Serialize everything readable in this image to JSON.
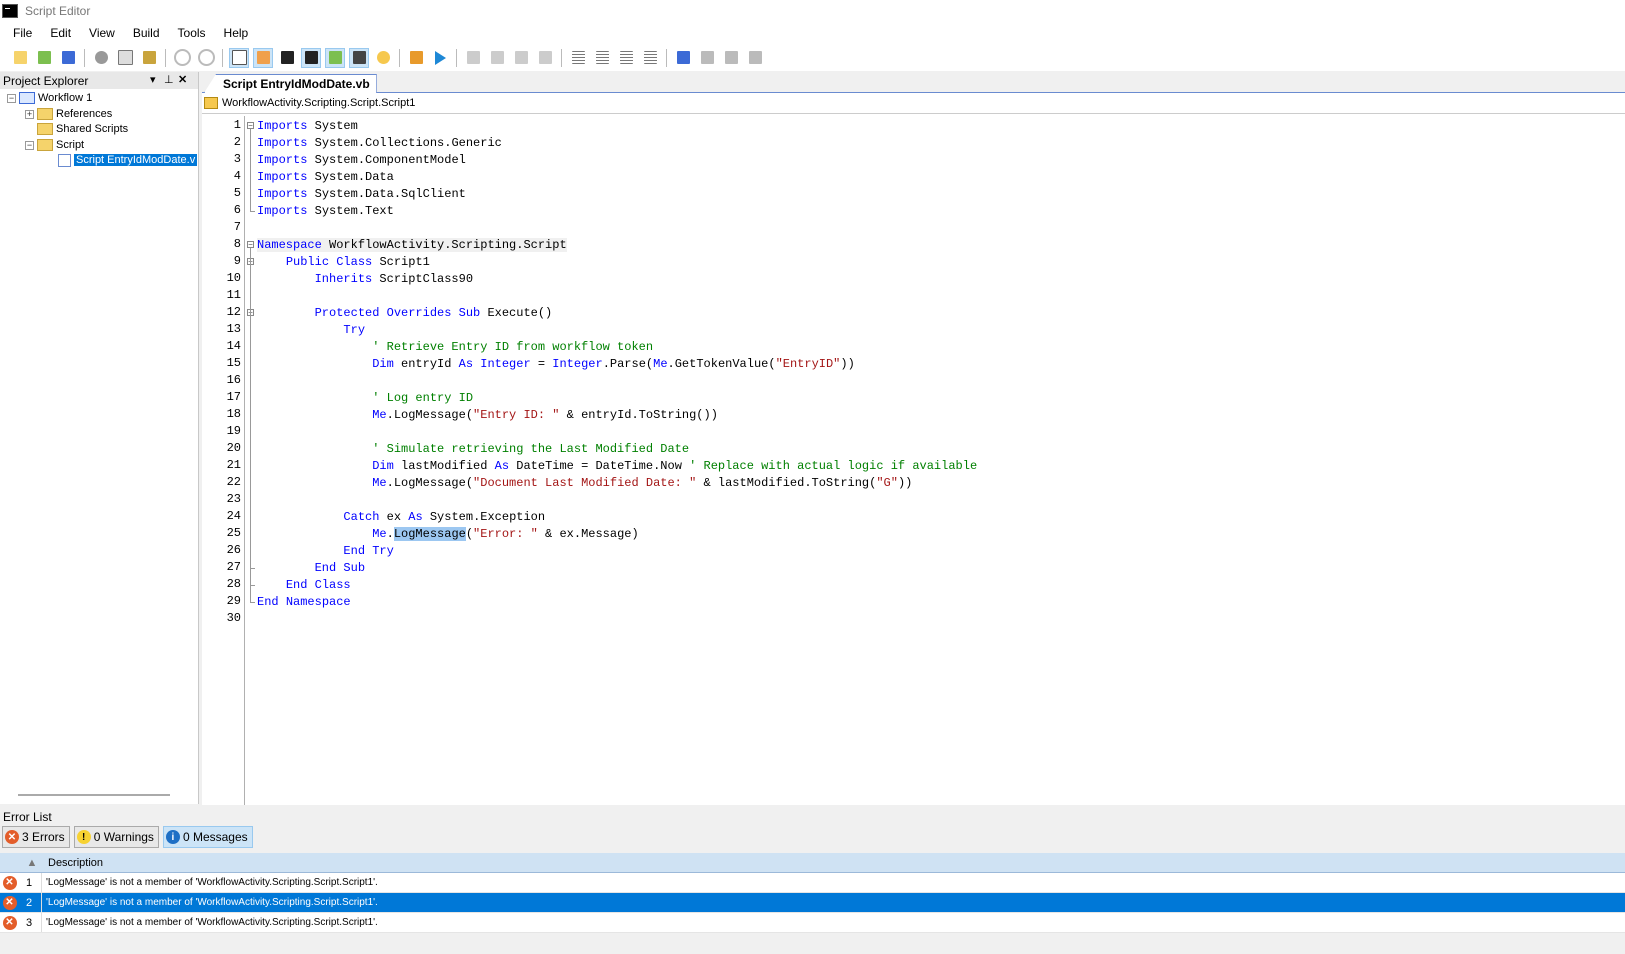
{
  "window": {
    "title": "Script Editor"
  },
  "menu": [
    "File",
    "Edit",
    "View",
    "Build",
    "Tools",
    "Help"
  ],
  "explorer": {
    "title": "Project Explorer",
    "tree": {
      "workflow": "Workflow 1",
      "references": "References",
      "shared_scripts": "Shared Scripts",
      "script_folder": "Script",
      "script_file": "Script EntryIdModDate.v"
    }
  },
  "editor": {
    "tab": "Script EntryIdModDate.vb",
    "nav_path": "WorkflowActivity.Scripting.Script.Script1",
    "line_numbers": [
      "1",
      "2",
      "3",
      "4",
      "5",
      "6",
      "7",
      "8",
      "9",
      "10",
      "11",
      "12",
      "13",
      "14",
      "15",
      "16",
      "17",
      "18",
      "19",
      "20",
      "21",
      "22",
      "23",
      "24",
      "25",
      "26",
      "27",
      "28",
      "29",
      "30"
    ],
    "code": [
      [
        {
          "t": "Imports",
          "c": "kw"
        },
        {
          "t": " System"
        }
      ],
      [
        {
          "t": "Imports",
          "c": "kw"
        },
        {
          "t": " System.Collections.Generic"
        }
      ],
      [
        {
          "t": "Imports",
          "c": "kw"
        },
        {
          "t": " System.ComponentModel"
        }
      ],
      [
        {
          "t": "Imports",
          "c": "kw"
        },
        {
          "t": " System.Data"
        }
      ],
      [
        {
          "t": "Imports",
          "c": "kw"
        },
        {
          "t": " System.Data.SqlClient"
        }
      ],
      [
        {
          "t": "Imports",
          "c": "kw"
        },
        {
          "t": " System.Text"
        }
      ],
      [],
      [
        {
          "t": "Namespace",
          "c": "kw nsbg"
        },
        {
          "t": " WorkflowActivity.Scripting.Script",
          "c": "nsbg"
        }
      ],
      [
        {
          "t": "    "
        },
        {
          "t": "Public",
          "c": "kw"
        },
        {
          "t": " "
        },
        {
          "t": "Class",
          "c": "kw"
        },
        {
          "t": " Script1"
        }
      ],
      [
        {
          "t": "        "
        },
        {
          "t": "Inherits",
          "c": "kw"
        },
        {
          "t": " ScriptClass90"
        }
      ],
      [],
      [
        {
          "t": "        "
        },
        {
          "t": "Protected",
          "c": "kw"
        },
        {
          "t": " "
        },
        {
          "t": "Overrides",
          "c": "kw"
        },
        {
          "t": " "
        },
        {
          "t": "Sub",
          "c": "kw"
        },
        {
          "t": " Execute()"
        }
      ],
      [
        {
          "t": "            "
        },
        {
          "t": "Try",
          "c": "kw"
        }
      ],
      [
        {
          "t": "                "
        },
        {
          "t": "' Retrieve Entry ID from workflow token",
          "c": "cm"
        }
      ],
      [
        {
          "t": "                "
        },
        {
          "t": "Dim",
          "c": "kw"
        },
        {
          "t": " entryId "
        },
        {
          "t": "As",
          "c": "kw"
        },
        {
          "t": " "
        },
        {
          "t": "Integer",
          "c": "kw"
        },
        {
          "t": " = "
        },
        {
          "t": "Integer",
          "c": "kw"
        },
        {
          "t": ".Parse("
        },
        {
          "t": "Me",
          "c": "kw"
        },
        {
          "t": ".GetTokenValue("
        },
        {
          "t": "\"EntryID\"",
          "c": "st"
        },
        {
          "t": "))"
        }
      ],
      [],
      [
        {
          "t": "                "
        },
        {
          "t": "' Log entry ID",
          "c": "cm"
        }
      ],
      [
        {
          "t": "                "
        },
        {
          "t": "Me",
          "c": "kw"
        },
        {
          "t": ".LogMessage("
        },
        {
          "t": "\"Entry ID: \"",
          "c": "st"
        },
        {
          "t": " & entryId.ToString())"
        }
      ],
      [],
      [
        {
          "t": "                "
        },
        {
          "t": "' Simulate retrieving the Last Modified Date",
          "c": "cm"
        }
      ],
      [
        {
          "t": "                "
        },
        {
          "t": "Dim",
          "c": "kw"
        },
        {
          "t": " lastModified "
        },
        {
          "t": "As",
          "c": "kw"
        },
        {
          "t": " DateTime = DateTime.Now "
        },
        {
          "t": "' Replace with actual logic if available",
          "c": "cm"
        }
      ],
      [
        {
          "t": "                "
        },
        {
          "t": "Me",
          "c": "kw"
        },
        {
          "t": ".LogMessage("
        },
        {
          "t": "\"Document Last Modified Date: \"",
          "c": "st"
        },
        {
          "t": " & lastModified.ToString("
        },
        {
          "t": "\"G\"",
          "c": "st"
        },
        {
          "t": "))"
        }
      ],
      [],
      [
        {
          "t": "            "
        },
        {
          "t": "Catch",
          "c": "kw"
        },
        {
          "t": " ex "
        },
        {
          "t": "As",
          "c": "kw"
        },
        {
          "t": " System.Exception"
        }
      ],
      [
        {
          "t": "                "
        },
        {
          "t": "Me",
          "c": "kw"
        },
        {
          "t": "."
        },
        {
          "t": "LogMessage",
          "c": "hl"
        },
        {
          "t": "("
        },
        {
          "t": "\"Error: \"",
          "c": "st"
        },
        {
          "t": " & ex.Message)"
        }
      ],
      [
        {
          "t": "            "
        },
        {
          "t": "End",
          "c": "kw"
        },
        {
          "t": " "
        },
        {
          "t": "Try",
          "c": "kw"
        }
      ],
      [
        {
          "t": "        "
        },
        {
          "t": "End",
          "c": "kw"
        },
        {
          "t": " "
        },
        {
          "t": "Sub",
          "c": "kw"
        }
      ],
      [
        {
          "t": "    "
        },
        {
          "t": "End",
          "c": "kw"
        },
        {
          "t": " "
        },
        {
          "t": "Class",
          "c": "kw"
        }
      ],
      [
        {
          "t": "End",
          "c": "kw"
        },
        {
          "t": " "
        },
        {
          "t": "Namespace",
          "c": "kw"
        }
      ],
      []
    ]
  },
  "error_list": {
    "title": "Error List",
    "filters": {
      "errors": "3 Errors",
      "warnings": "0 Warnings",
      "messages": "0 Messages"
    },
    "column_description": "Description",
    "rows": [
      {
        "num": "1",
        "desc": "'LogMessage' is not a member of 'WorkflowActivity.Scripting.Script.Script1'."
      },
      {
        "num": "2",
        "desc": "'LogMessage' is not a member of 'WorkflowActivity.Scripting.Script.Script1'."
      },
      {
        "num": "3",
        "desc": "'LogMessage' is not a member of 'WorkflowActivity.Scripting.Script.Script1'."
      }
    ]
  },
  "colors": {
    "keyword": "#0000ff",
    "comment": "#008000",
    "string": "#a31515",
    "selection": "#0078d7",
    "error_icon": "#e35d2a"
  }
}
